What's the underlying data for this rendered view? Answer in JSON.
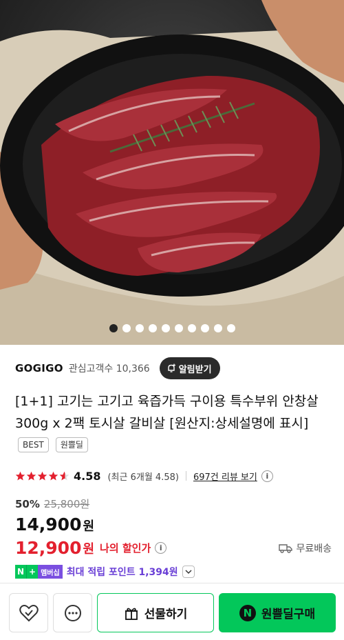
{
  "image": {
    "alt_icon": "product-photo-grilled-beef",
    "slide_count": 10,
    "active_slide": 0
  },
  "seller": {
    "name": "GOGIGO",
    "fans_label": "관심고객수",
    "fans_count": "10,366",
    "alert_label": "알림받기"
  },
  "product": {
    "title": "[1+1] 고기는 고기고 육즙가득 구이용 특수부위 안창살 300g x 2팩 토시살 갈비살 [원산지:상세설명에 표시]",
    "tags": [
      "BEST",
      "원쁠딜"
    ]
  },
  "rating": {
    "score": "4.58",
    "stars": 4.58,
    "recent": "(최근 6개월 4.58)",
    "reviews": "697건 리뷰 보기"
  },
  "price": {
    "discount": "50%",
    "original": "25,800원",
    "sale": "14,900",
    "won": "원",
    "my_price": "12,900",
    "my_won": "원",
    "my_label": "나의 할인가",
    "shipping": "무료배송"
  },
  "points": {
    "badge_n": "N",
    "badge_plus": "+",
    "badge_member": "멤버십",
    "text": "최대 적립 포인트 1,394원"
  },
  "actions": {
    "gift": "선물하기",
    "buy": "원쁠딜구매",
    "buy_badge": "N"
  },
  "colors": {
    "green": "#03c75a",
    "red": "#e3202e",
    "purple": "#6a3fd6"
  }
}
